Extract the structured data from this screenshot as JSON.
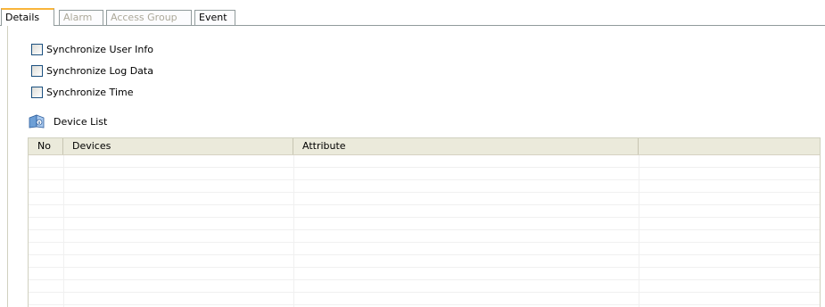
{
  "tabs": [
    {
      "label": "Details",
      "state": "active"
    },
    {
      "label": "Alarm",
      "state": "disabled"
    },
    {
      "label": "Access Group",
      "state": "disabled"
    },
    {
      "label": "Event",
      "state": "enabled"
    }
  ],
  "options": {
    "sync_user_info": "Synchronize User Info",
    "sync_log_data": "Synchronize Log Data",
    "sync_time": "Synchronize Time"
  },
  "device_list": {
    "title": "Device List",
    "icon": "device-list-icon",
    "columns": [
      "No",
      "Devices",
      "Attribute",
      ""
    ],
    "rows": []
  },
  "colors": {
    "active_tab_accent": "#f9b53a",
    "header_bg": "#ebeadb",
    "checkbox_border": "#1c5180",
    "disabled_text": "#aca899"
  }
}
